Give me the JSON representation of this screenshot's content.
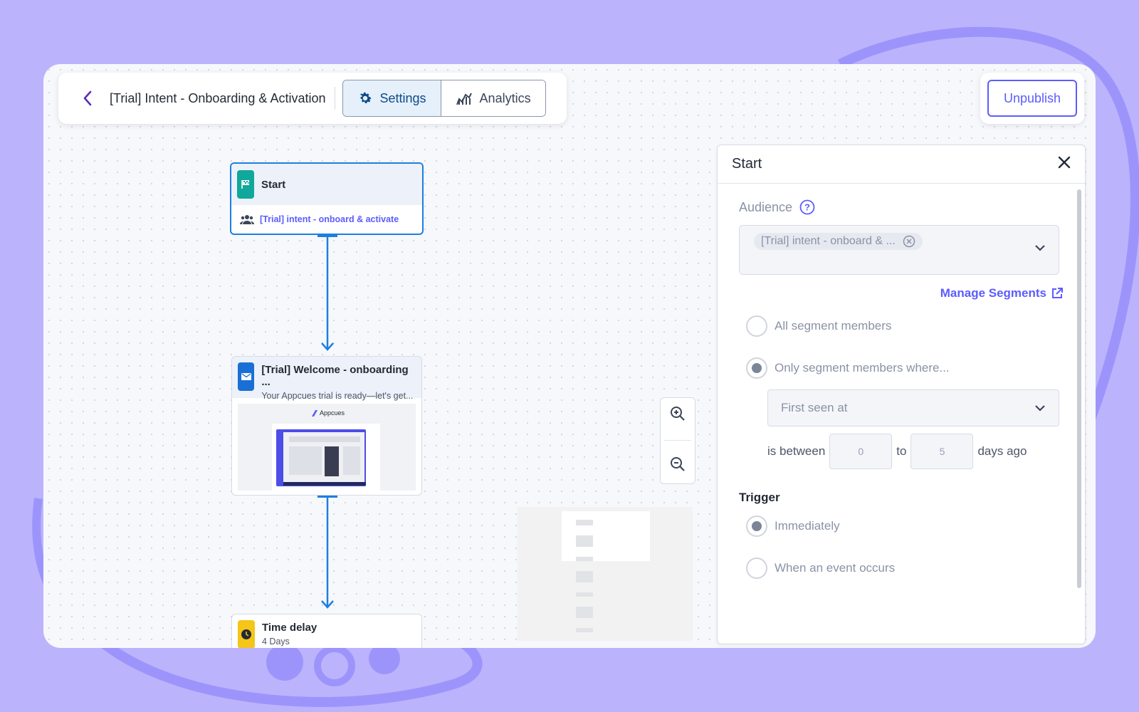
{
  "header": {
    "flow_title": "[Trial] Intent - Onboarding & Activation",
    "tabs": [
      {
        "label": "Settings",
        "icon": "gear-icon",
        "active": true
      },
      {
        "label": "Analytics",
        "icon": "chart-icon",
        "active": false
      }
    ],
    "unpublish_label": "Unpublish"
  },
  "nodes": {
    "start": {
      "title": "Start",
      "audience": "[Trial] intent - onboard & activate"
    },
    "email": {
      "title": "[Trial] Welcome - onboarding ...",
      "subtitle": "Your Appcues trial is ready—let's get...",
      "preview_brand": "Appcues"
    },
    "delay": {
      "title": "Time delay",
      "subtitle": "4 Days"
    }
  },
  "panel": {
    "title": "Start",
    "audience_label": "Audience",
    "audience_chip": "[Trial] intent - onboard & ...",
    "manage_segments": "Manage Segments",
    "radio_all": "All segment members",
    "radio_only": "Only segment members where...",
    "property_select": "First seen at",
    "is_between": "is between",
    "from_value": "0",
    "to_label": "to",
    "to_value": "5",
    "days_ago": "days ago",
    "trigger_label": "Trigger",
    "trigger_immediately": "Immediately",
    "trigger_event": "When an event occurs"
  },
  "colors": {
    "background": "#bbb4fc",
    "accent": "#5c5cff",
    "connector": "#1c7fe0",
    "start_icon": "#0fa89a",
    "email_icon": "#1a6fd6",
    "delay_icon": "#f5c518"
  }
}
